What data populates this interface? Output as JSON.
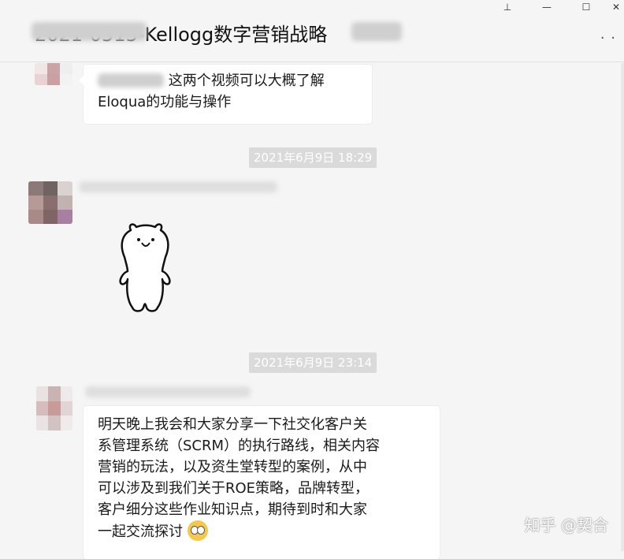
{
  "window": {
    "title": "2021-0513-Kellogg数字营销战略",
    "controls": {
      "pin": "⊥",
      "minimize": "—",
      "maximize": "☐",
      "close": "✕"
    },
    "more_menu": "· ·"
  },
  "messages": [
    {
      "sender": "",
      "text_line1": "这两个视频可以大概了解",
      "text_line2": "Eloqua的功能与操作"
    },
    {
      "sender": "",
      "type": "sticker",
      "sticker": "white-bear-sticker"
    },
    {
      "sender": "",
      "lines": [
        "明天晚上我会和大家分享一下社交化客户关",
        "系管理系统（SCRM）的执行路线，相关内容",
        "营销的玩法，以及资生堂转型的案例，从中",
        "可以涉及到我们关于ROE策略，品牌转型，",
        "客户细分这些作业知识点，期待到时和大家",
        "一起交流探讨"
      ],
      "emoji": "grimace-emoji"
    }
  ],
  "timestamps": [
    "2021年6月9日 18:29",
    "2021年6月9日 23:14"
  ],
  "watermark": "知乎 @契合"
}
